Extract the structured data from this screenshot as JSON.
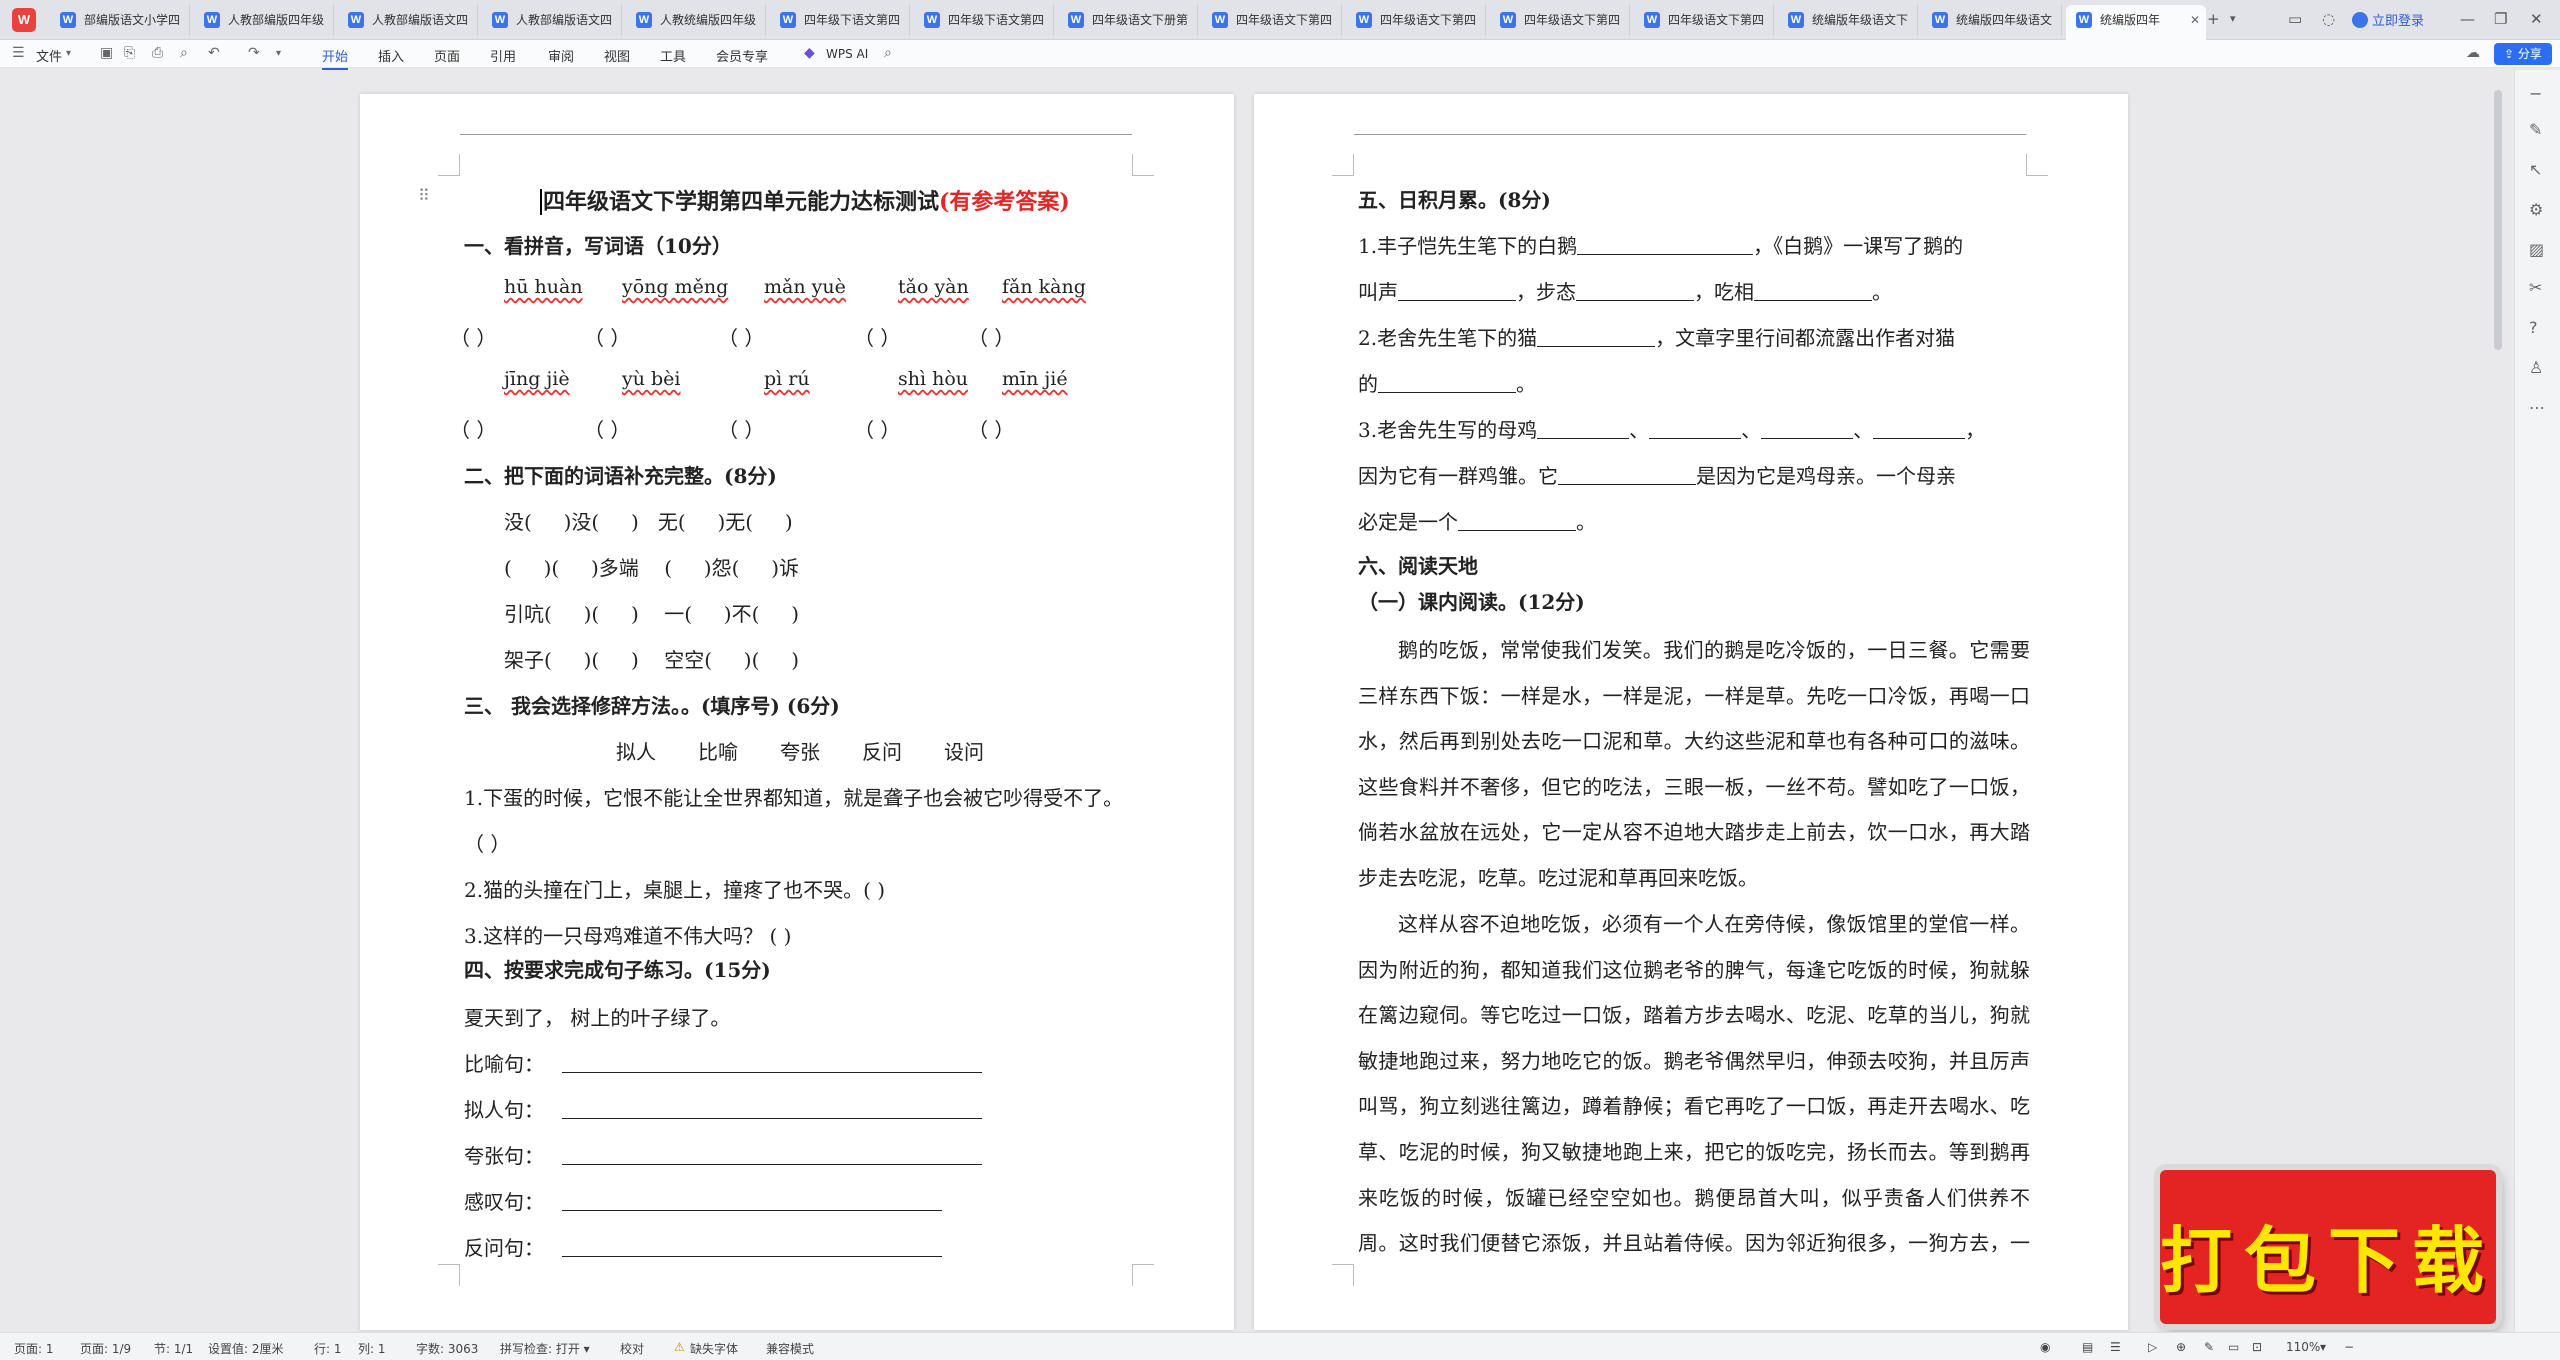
{
  "tabs": [
    "部编版语文小学四",
    "人教部编版四年级",
    "人教部编版语文四",
    "人教部编版语文四",
    "人教统编版四年级",
    "四年级下语文第四",
    "四年级下语文第四",
    "四年级语文下册第",
    "四年级语文下第四",
    "四年级语文下第四",
    "四年级语文下第四",
    "四年级语文下第四",
    "统编版年级语文下",
    "统编版四年级语文",
    "统编版四年"
  ],
  "login_label": "立即登录",
  "ribbon": {
    "file": "文件",
    "menus": [
      "开始",
      "插入",
      "页面",
      "引用",
      "审阅",
      "视图",
      "工具",
      "会员专享"
    ],
    "wps_ai": "WPS AI",
    "share": "分享"
  },
  "page1": {
    "title": "四年级语文下学期第四单元能力达标测试",
    "title_suffix": "(有参考答案)",
    "s1": "一、看拼音，写词语（10分）",
    "py_row1": [
      "hū huàn",
      "yōng měng",
      "mǎn yuè",
      "tǎo yàn",
      "fǎn kàng"
    ],
    "py_row2": [
      "jīng jiè",
      "yù bèi",
      "pì rú",
      "shì hòu",
      "mīn jié"
    ],
    "paren": "（         ）",
    "s2": "二、把下面的词语补充完整。(8分)",
    "fill": [
      "没(     )没(     )   无(     )无(     )",
      "(     )(     )多端    (     )怨(     )诉",
      "引吭(     )(     )    一(     )不(     )",
      "架子(     )(     )    空空(     )(     )"
    ],
    "s3": "三、  我会选择修辞方法。。(填序号)      (6分)",
    "methods": [
      "拟人",
      "比喻",
      "夸张",
      "反问",
      "设问"
    ],
    "q1": "1.下蛋的时候，它恨不能让全世界都知道，就是聋子也会被它吵得受不了。",
    "q1b": "（      ）",
    "q2": "2.猫的头撞在门上，桌腿上，撞疼了也不哭。(      )",
    "q3": "3.这样的一只母鸡难道不伟大吗？ (      )",
    "s4": "四、按要求完成句子练习。(15分)",
    "base": "夏天到了，  树上的叶子绿了。",
    "transforms": [
      "比喻句：",
      "拟人句：",
      "夸张句：",
      "感叹句：",
      "反问句："
    ]
  },
  "page2": {
    "s5": "五、日积月累。(8分)",
    "l1a": "1.丰子恺先生笔下的白鹅",
    "l1b": "，《白鹅》一课写了鹅的",
    "l2a": "叫声",
    "l2b": "，步态",
    "l2c": "，吃相",
    "l2d": "。",
    "l3a": "2.老舍先生笔下的猫",
    "l3b": "，文章字里行间都流露出作者对猫",
    "l4a": "的",
    "l4b": "。",
    "l5a": "3.老舍先生写的母鸡",
    "sep": "、",
    "l5end": "，",
    "l6a": "因为它有一群鸡雏。它",
    "l6b": "是因为它是鸡母亲。一个母亲",
    "l7a": "必定是一个",
    "l7b": "。",
    "s6": "六、阅读天地",
    "s6a": "（一）课内阅读。(12分)",
    "p1": "鹅的吃饭，常常使我们发笑。我们的鹅是吃冷饭的，一日三餐。它需要三样东西下饭：一样是水，一样是泥，一样是草。先吃一口冷饭，再喝一口水，然后再到别处去吃一口泥和草。大约这些泥和草也有各种可口的滋味。这些食料并不奢侈，但它的吃法，三眼一板，一丝不苟。譬如吃了一口饭，倘若水盆放在远处，它一定从容不迫地大踏步走上前去，饮一口水，再大踏步走去吃泥，吃草。吃过泥和草再回来吃饭。",
    "p2": "这样从容不迫地吃饭，必须有一个人在旁侍候，像饭馆里的堂倌一样。因为附近的狗，都知道我们这位鹅老爷的脾气，每逢它吃饭的时候，狗就躲在篱边窥伺。等它吃过一口饭，踏着方步去喝水、吃泥、吃草的当儿，狗就敏捷地跑过来，努力地吃它的饭。鹅老爷偶然早归，伸颈去咬狗，并且厉声叫骂，狗立刻逃往篱边，蹲着静候；看它再吃了一口饭，再走开去喝水、吃草、吃泥的时候，狗又敏捷地跑上来，把它的饭吃完，扬长而去。等到鹅再来吃饭的时候，饭罐已经空空如也。鹅便昂首大叫，似乎责备人们供养不周。这时我们便替它添饭，并且站着侍候。因为邻近狗很多，一狗方去，一狗又"
  },
  "status": {
    "page": "页面: 1",
    "pages": "页面: 1/9",
    "section": "节: 1/1",
    "setting": "设置值: 2厘米",
    "row": "行: 1",
    "col": "列: 1",
    "words": "字数: 3063",
    "spell": "拼写检查: 打开 ▾",
    "proof": "校对",
    "font_missing": "缺失字体",
    "compat": "兼容模式",
    "zoom": "110%"
  },
  "badge": "打包下载"
}
